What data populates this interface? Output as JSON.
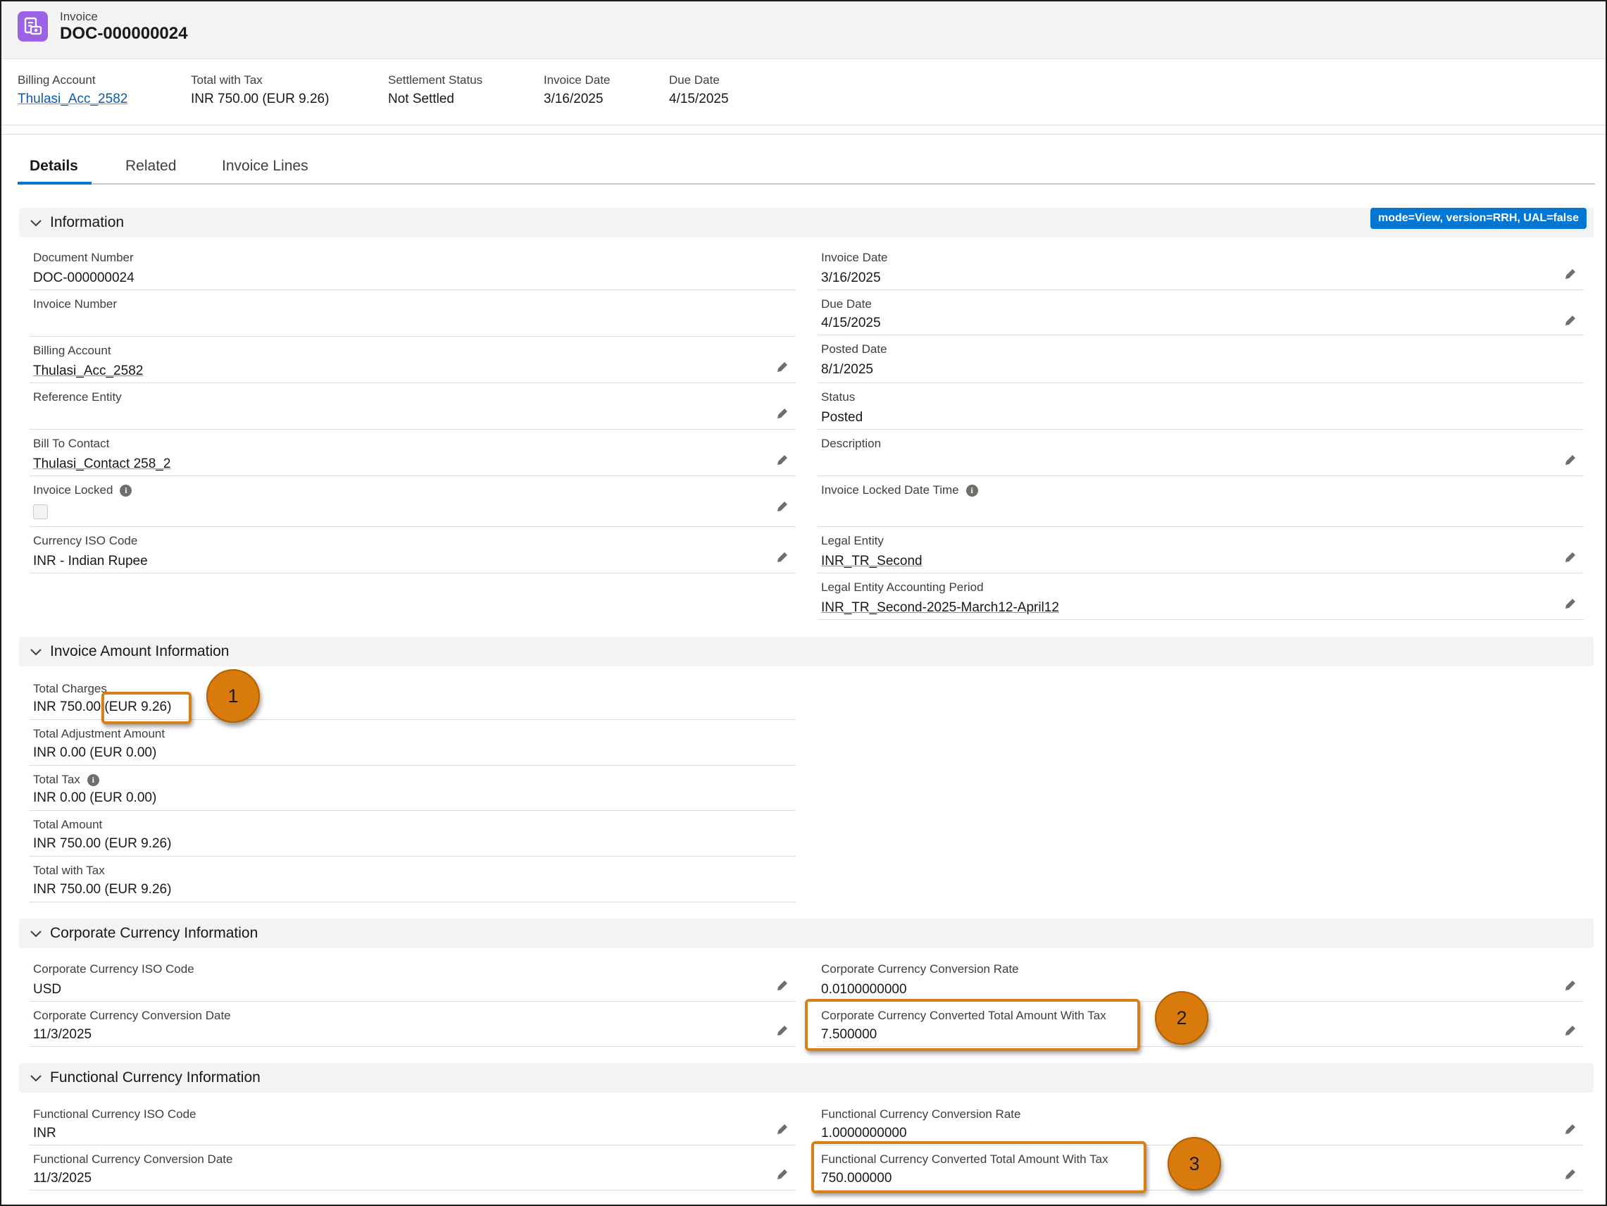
{
  "header": {
    "object_type": "Invoice",
    "title": "DOC-000000024",
    "icon": "invoice-icon",
    "icon_color": "#9b62e6"
  },
  "highlights": [
    {
      "label": "Billing Account",
      "value": "Thulasi_Acc_2582",
      "link": true
    },
    {
      "label": "Total with Tax",
      "value": "INR 750.00 (EUR 9.26)",
      "link": false
    },
    {
      "label": "Settlement Status",
      "value": "Not Settled",
      "link": false
    },
    {
      "label": "Invoice Date",
      "value": "3/16/2025",
      "link": false
    },
    {
      "label": "Due Date",
      "value": "4/15/2025",
      "link": false
    }
  ],
  "tabs": [
    {
      "label": "Details",
      "active": true
    },
    {
      "label": "Related",
      "active": false
    },
    {
      "label": "Invoice Lines",
      "active": false
    }
  ],
  "badge": "mode=View, version=RRH, UAL=false",
  "sections": {
    "information": {
      "title": "Information",
      "left": [
        {
          "label": "Document Number",
          "value": "DOC-000000024"
        },
        {
          "label": "Invoice Number",
          "value": ""
        },
        {
          "label": "Billing Account",
          "value": "Thulasi_Acc_2582"
        },
        {
          "label": "Reference Entity",
          "value": ""
        },
        {
          "label": "Bill To Contact",
          "value": "Thulasi_Contact 258_2"
        },
        {
          "label": "Invoice Locked",
          "value": ""
        },
        {
          "label": "Currency ISO Code",
          "value": "INR - Indian Rupee"
        }
      ],
      "right": [
        {
          "label": "Invoice Date",
          "value": "3/16/2025"
        },
        {
          "label": "Due Date",
          "value": "4/15/2025"
        },
        {
          "label": "Posted Date",
          "value": "8/1/2025"
        },
        {
          "label": "Status",
          "value": "Posted"
        },
        {
          "label": "Description",
          "value": ""
        },
        {
          "label": "Invoice Locked Date Time",
          "value": ""
        },
        {
          "label": "Legal Entity",
          "value": "INR_TR_Second"
        },
        {
          "label": "Legal Entity Accounting Period",
          "value": "INR_TR_Second-2025-March12-April12"
        }
      ]
    },
    "amount": {
      "title": "Invoice Amount Information",
      "fields": [
        {
          "label": "Total Charges",
          "value": "INR 750.00 (EUR 9.26)"
        },
        {
          "label": "Total Adjustment Amount",
          "value": "INR 0.00 (EUR 0.00)"
        },
        {
          "label": "Total Tax",
          "value": "INR 0.00 (EUR 0.00)"
        },
        {
          "label": "Total Amount",
          "value": "INR 750.00 (EUR 9.26)"
        },
        {
          "label": "Total with Tax",
          "value": "INR 750.00 (EUR 9.26)"
        }
      ]
    },
    "corporate": {
      "title": "Corporate Currency Information",
      "left": [
        {
          "label": "Corporate Currency ISO Code",
          "value": "USD"
        },
        {
          "label": "Corporate Currency Conversion Date",
          "value": "11/3/2025"
        }
      ],
      "right": [
        {
          "label": "Corporate Currency Conversion Rate",
          "value": "0.0100000000"
        },
        {
          "label": "Corporate Currency Converted Total Amount With Tax",
          "value": "7.500000"
        }
      ]
    },
    "functional": {
      "title": "Functional Currency Information",
      "left": [
        {
          "label": "Functional Currency ISO Code",
          "value": "INR"
        },
        {
          "label": "Functional Currency Conversion Date",
          "value": "11/3/2025"
        }
      ],
      "right": [
        {
          "label": "Functional Currency Conversion Rate",
          "value": "1.0000000000"
        },
        {
          "label": "Functional Currency Converted Total Amount With Tax",
          "value": "750.000000"
        }
      ]
    }
  },
  "callouts": [
    "1",
    "2",
    "3"
  ],
  "colors": {
    "link": "#0b5cab",
    "badge": "#0176d3",
    "callout": "#d97b0c",
    "tab_active": "#0176d3"
  }
}
